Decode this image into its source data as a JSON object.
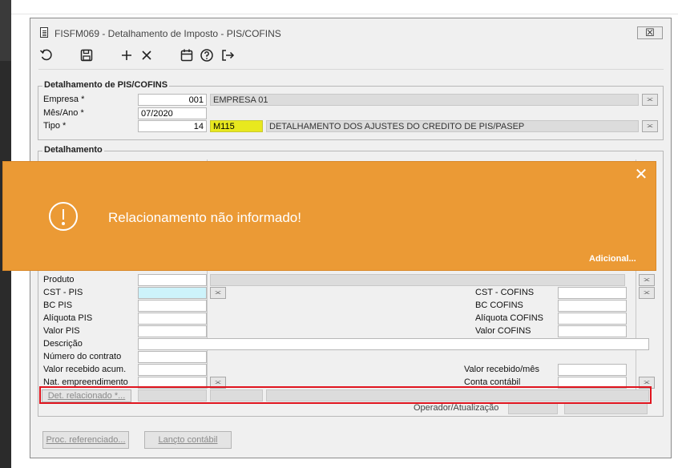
{
  "window": {
    "title": "FISFM069 - Detalhamento de Imposto - PIS/COFINS",
    "close_glyph": "☒"
  },
  "toolbar": {
    "icons": [
      "refresh-icon",
      "save-icon",
      "add-icon",
      "delete-icon",
      "calendar-icon",
      "help-icon",
      "exit-icon"
    ]
  },
  "header_group": {
    "title": "Detalhamento de PIS/COFINS",
    "empresa_label": "Empresa *",
    "empresa_value": "001",
    "empresa_desc": "EMPRESA 01",
    "mesano_label": "Mês/Ano *",
    "mesano_value": "07/2020",
    "tipo_label": "Tipo *",
    "tipo_value": "14",
    "tipo_code": "M115",
    "tipo_desc": "DETALHAMENTO DOS AJUSTES DO CREDITO DE PIS/PASEP"
  },
  "detail_group": {
    "title": "Detalhamento",
    "produto_label": "Produto",
    "cst_pis_label": "CST - PIS",
    "bc_pis_label": "BC PIS",
    "aliquota_pis_label": "Alíquota PIS",
    "valor_pis_label": "Valor PIS",
    "cst_cofins_label": "CST - COFINS",
    "bc_cofins_label": "BC COFINS",
    "aliquota_cofins_label": "Alíquota COFINS",
    "valor_cofins_label": "Valor COFINS",
    "descricao_label": "Descrição",
    "numero_contrato_label": "Número do contrato",
    "valor_recebido_acum_label": "Valor recebido acum.",
    "valor_recebido_mes_label": "Valor recebido/mês",
    "nat_empreendimento_label": "Nat. empreendimento",
    "conta_contabil_label": "Conta contábil",
    "det_relacionado_label": "Det. relacionado *...",
    "operador_label": "Operador/Atualização"
  },
  "buttons": {
    "proc_referenciado": "Proc. referenciado...",
    "lancto_contabil": "Lançto contábil"
  },
  "toast": {
    "message": "Relacionamento não informado!",
    "more_link": "Adicional...",
    "close_glyph": "✕",
    "color": "#eb9a35"
  },
  "colors": {
    "highlight_border": "#e0151f",
    "yellow_field": "#e8e81e",
    "cyan_field": "#cdf3fb"
  }
}
